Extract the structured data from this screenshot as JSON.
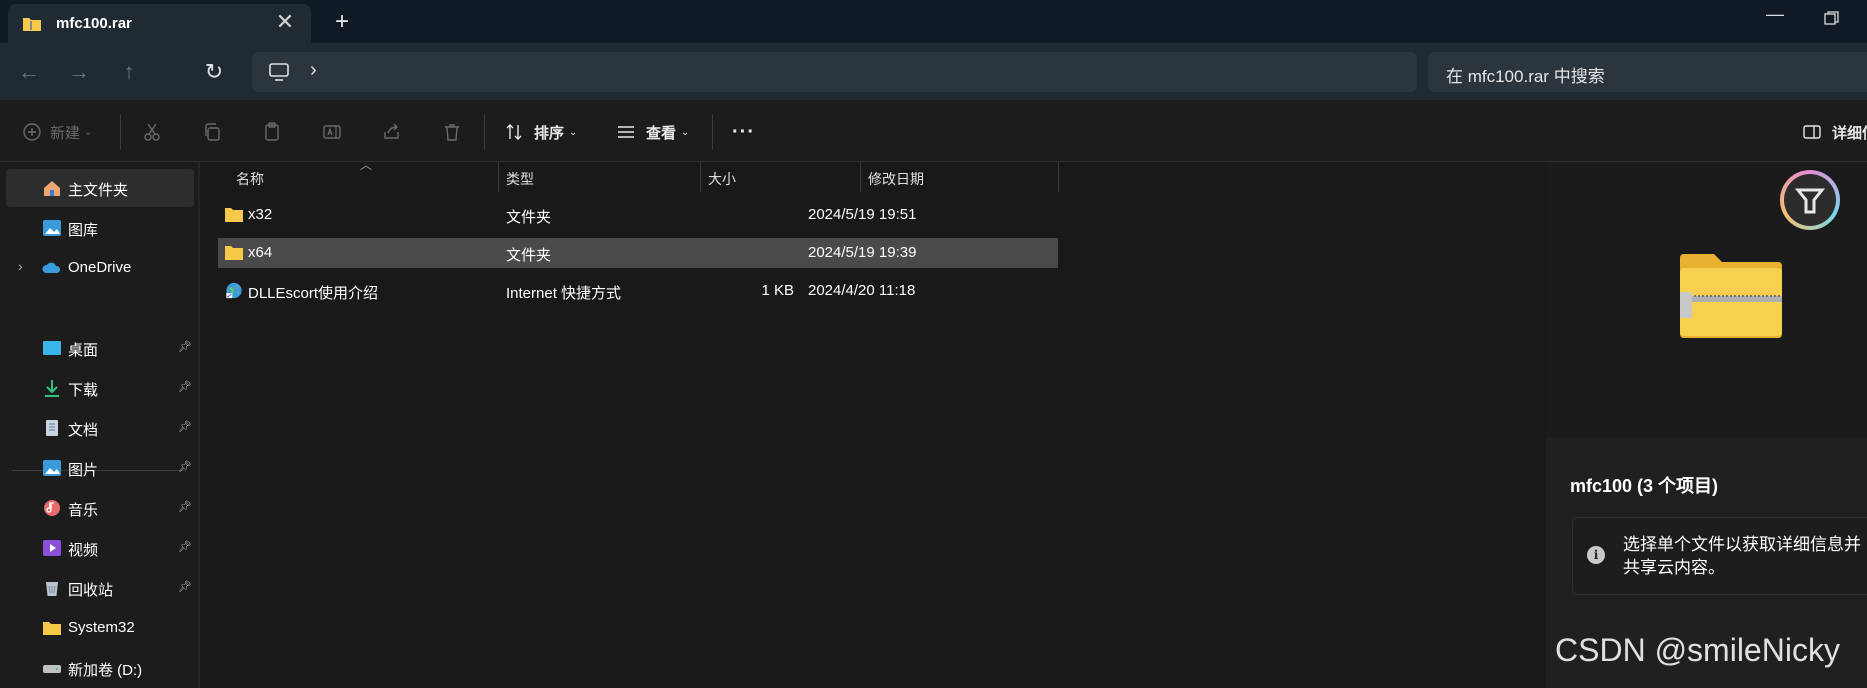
{
  "tab": {
    "title": "mfc100.rar",
    "close": "✕",
    "new_tab": "+"
  },
  "window": {
    "minimize": "—"
  },
  "nav": {
    "back": "←",
    "forward": "→",
    "up": "↑",
    "refresh": "↻",
    "chevron": "›"
  },
  "search": {
    "placeholder": "在 mfc100.rar 中搜索"
  },
  "toolbar": {
    "new_label": "新建",
    "sort_label": "排序",
    "view_label": "查看",
    "more": "···",
    "details_label": "详细信息"
  },
  "sidebar": {
    "items": [
      {
        "label": "主文件夹",
        "icon": "home-icon",
        "pinned": false
      },
      {
        "label": "图库",
        "icon": "gallery-icon",
        "pinned": false
      },
      {
        "label": "OneDrive",
        "icon": "cloud-icon",
        "pinned": false
      },
      {
        "label": "桌面",
        "icon": "desktop-icon",
        "pinned": true
      },
      {
        "label": "下载",
        "icon": "download-icon",
        "pinned": true
      },
      {
        "label": "文档",
        "icon": "document-icon",
        "pinned": true
      },
      {
        "label": "图片",
        "icon": "pictures-icon",
        "pinned": true
      },
      {
        "label": "音乐",
        "icon": "music-icon",
        "pinned": true
      },
      {
        "label": "视频",
        "icon": "video-icon",
        "pinned": true
      },
      {
        "label": "回收站",
        "icon": "recycle-bin-icon",
        "pinned": true
      },
      {
        "label": "System32",
        "icon": "folder-icon",
        "pinned": false
      },
      {
        "label": "新加卷 (D:)",
        "icon": "drive-icon",
        "pinned": false
      }
    ]
  },
  "columns": {
    "name": "名称",
    "type": "类型",
    "size": "大小",
    "modified": "修改日期"
  },
  "files": [
    {
      "name": "x32",
      "type": "文件夹",
      "size": "",
      "modified": "2024/5/19 19:51",
      "icon": "folder-icon"
    },
    {
      "name": "x64",
      "type": "文件夹",
      "size": "",
      "modified": "2024/5/19 19:39",
      "icon": "folder-icon"
    },
    {
      "name": "DLLEscort使用介绍",
      "type": "Internet 快捷方式",
      "size": "1 KB",
      "modified": "2024/4/20 11:18",
      "icon": "internet-shortcut-icon"
    }
  ],
  "details": {
    "title": "mfc100 (3 个项目)",
    "info_line1": "选择单个文件以获取详细信息并",
    "info_line2": "共享云内容。",
    "info_icon": "i"
  },
  "watermark": "CSDN @smileNicky",
  "colors": {
    "folder": "#f7c948",
    "selected_row": "#4a4a4a",
    "accent_blue": "#3a9bdc"
  }
}
